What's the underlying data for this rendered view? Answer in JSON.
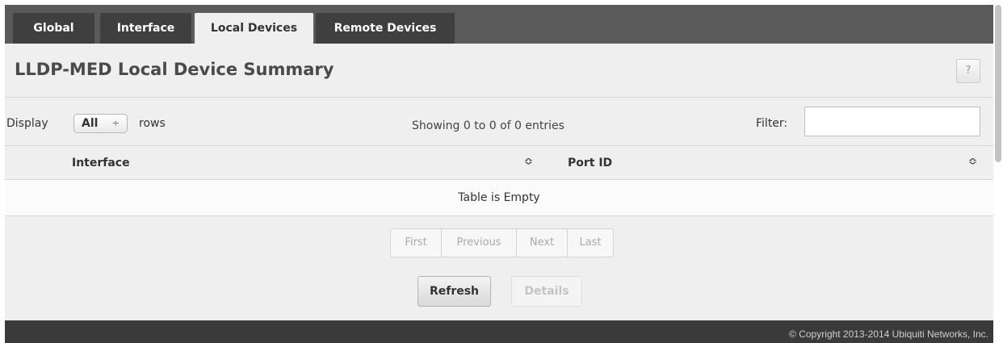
{
  "tabs": [
    {
      "label": "Global"
    },
    {
      "label": "Interface"
    },
    {
      "label": "Local Devices"
    },
    {
      "label": "Remote Devices"
    }
  ],
  "page": {
    "title": "LLDP-MED Local Device Summary",
    "help_label": "?"
  },
  "controls": {
    "display_label": "Display",
    "display_value": "All",
    "select_arrows": "÷",
    "rows_label": "rows",
    "entries_info": "Showing 0 to 0 of 0 entries",
    "filter_label": "Filter:",
    "filter_value": ""
  },
  "table": {
    "columns": [
      "Interface",
      "Port ID"
    ],
    "sort_glyph": "≎",
    "empty_text": "Table is Empty"
  },
  "pagination": {
    "first": "First",
    "previous": "Previous",
    "next": "Next",
    "last": "Last"
  },
  "buttons": {
    "refresh": "Refresh",
    "details": "Details"
  },
  "footer": {
    "copyright": "© Copyright 2013-2014 Ubiquiti Networks, Inc."
  },
  "colors": {
    "tabbar": "#5a5a5a",
    "tab": "#3f3f3f",
    "tab_active": "#efefef",
    "footer": "#3a3a3a"
  }
}
